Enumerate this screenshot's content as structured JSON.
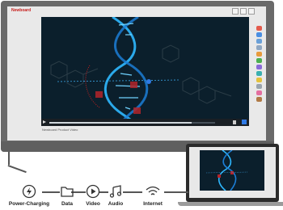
{
  "app": {
    "logo_text": "Newboard"
  },
  "video": {
    "caption": "Newboard Product Video",
    "progress": 0.86
  },
  "ports": [
    {
      "label": "Power-Charging",
      "icon": "power-icon"
    },
    {
      "label": "Data",
      "icon": "folder-icon"
    },
    {
      "label": "Video",
      "icon": "play-icon"
    },
    {
      "label": "Audio",
      "icon": "music-note-icon"
    },
    {
      "label": "Internet",
      "icon": "wifi-icon"
    }
  ],
  "colors": {
    "brand": "#c8201e",
    "video_bg": "#0b1f2c",
    "dna_blue": "#2fb8ff"
  }
}
